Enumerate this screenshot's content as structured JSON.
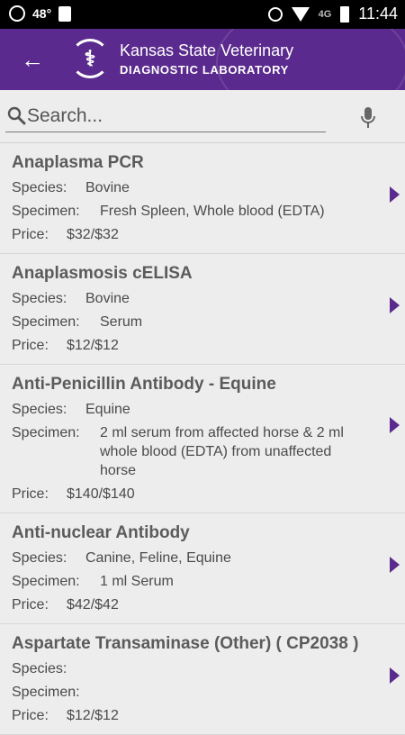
{
  "status": {
    "temperature": "48°",
    "time": "11:44",
    "network": "4G"
  },
  "header": {
    "brand_line1": "Kansas State Veterinary",
    "brand_line2": "DIAGNOSTIC LABORATORY"
  },
  "search": {
    "placeholder": "Search..."
  },
  "labels": {
    "species": "Species:",
    "specimen": "Specimen:",
    "price": "Price:"
  },
  "items": [
    {
      "name": "Anaplasma PCR",
      "species": "Bovine",
      "specimen": "Fresh Spleen, Whole blood (EDTA)",
      "price": "$32/$32"
    },
    {
      "name": "Anaplasmosis cELISA",
      "species": "Bovine",
      "specimen": "Serum",
      "price": "$12/$12"
    },
    {
      "name": "Anti-Penicillin Antibody - Equine",
      "species": "Equine",
      "specimen": "2 ml serum from affected horse & 2 ml whole blood (EDTA) from unaffected horse",
      "price": "$140/$140"
    },
    {
      "name": "Anti-nuclear Antibody",
      "species": "Canine, Feline, Equine",
      "specimen": "1 ml Serum",
      "price": "$42/$42"
    },
    {
      "name": "Aspartate Transaminase (Other) ( CP2038 )",
      "species": "",
      "specimen": "",
      "price": "$12/$12"
    }
  ],
  "colors": {
    "brand": "#5a2a8e",
    "background": "#ededed",
    "statusbar": "#000000"
  },
  "icons": [
    "signal-app-icon",
    "clipboard-icon",
    "alarm-icon",
    "wifi-icon",
    "battery-icon",
    "back-arrow-icon",
    "search-icon",
    "mic-icon",
    "chevron-right-icon"
  ]
}
